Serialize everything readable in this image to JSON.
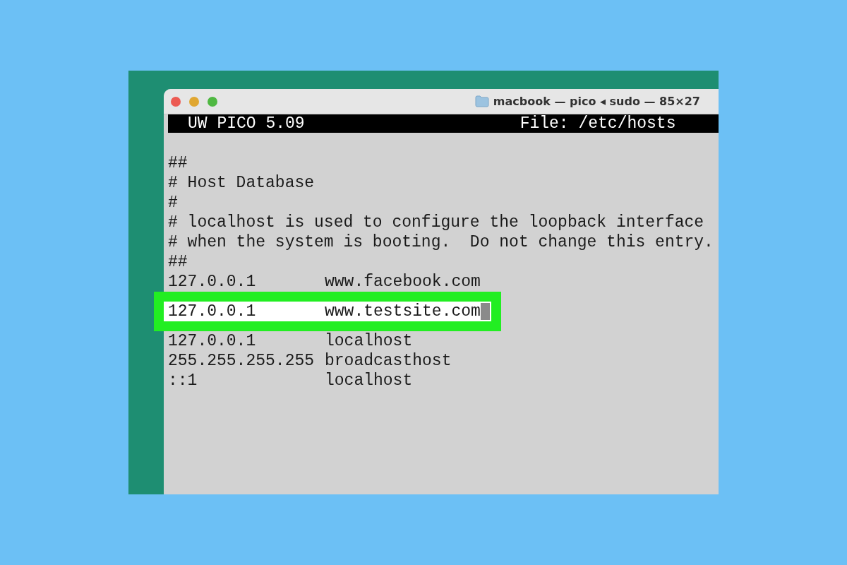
{
  "window": {
    "title": "macbook — pico ◂ sudo — 85×27"
  },
  "editor": {
    "app": "UW PICO 5.09",
    "file": "File: /etc/hosts"
  },
  "comments": [
    "##",
    "# Host Database",
    "#",
    "# localhost is used to configure the loopback interface",
    "# when the system is booting.  Do not change this entry.",
    "##"
  ],
  "entries": [
    {
      "address": "127.0.0.1",
      "hostname": "www.facebook.com",
      "highlighted": false,
      "cursor": false
    },
    {
      "address": "127.0.0.1",
      "hostname": "www.testsite.com",
      "highlighted": true,
      "cursor": true
    },
    {
      "address": "127.0.0.1",
      "hostname": "localhost",
      "highlighted": false,
      "cursor": false
    },
    {
      "address": "255.255.255.255",
      "hostname": "broadcasthost",
      "highlighted": false,
      "cursor": false
    },
    {
      "address": "::1",
      "hostname": "localhost",
      "highlighted": false,
      "cursor": false
    }
  ]
}
